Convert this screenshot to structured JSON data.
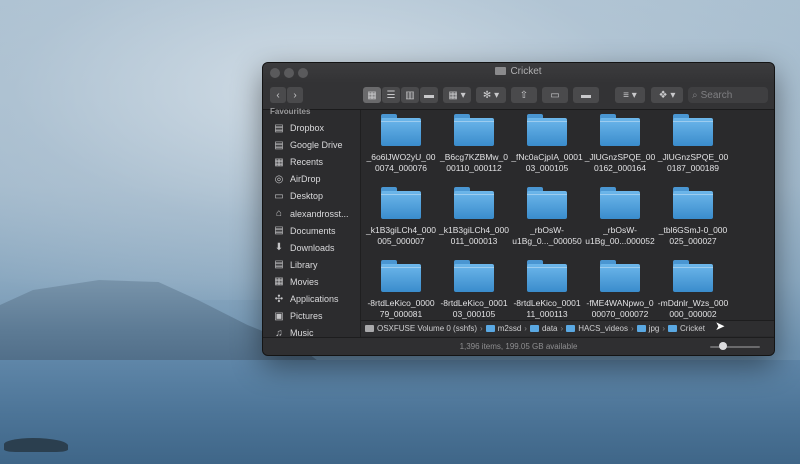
{
  "window": {
    "title": "Cricket"
  },
  "toolbar": {
    "back": "‹",
    "forward": "›",
    "search_placeholder": "Search"
  },
  "sidebar": {
    "heading": "Favourites",
    "items": [
      {
        "label": "Dropbox",
        "icon": "dropbox-icon",
        "glyph": "▤"
      },
      {
        "label": "Google Drive",
        "icon": "google-drive-icon",
        "glyph": "▤"
      },
      {
        "label": "Recents",
        "icon": "recents-icon",
        "glyph": "▦"
      },
      {
        "label": "AirDrop",
        "icon": "airdrop-icon",
        "glyph": "◎"
      },
      {
        "label": "Desktop",
        "icon": "desktop-icon",
        "glyph": "▭"
      },
      {
        "label": "alexandrosst...",
        "icon": "home-icon",
        "glyph": "⌂"
      },
      {
        "label": "Documents",
        "icon": "documents-icon",
        "glyph": "▤"
      },
      {
        "label": "Downloads",
        "icon": "downloads-icon",
        "glyph": "⬇"
      },
      {
        "label": "Library",
        "icon": "library-icon",
        "glyph": "▤"
      },
      {
        "label": "Movies",
        "icon": "movies-icon",
        "glyph": "▦"
      },
      {
        "label": "Applications",
        "icon": "applications-icon",
        "glyph": "✣"
      },
      {
        "label": "Pictures",
        "icon": "pictures-icon",
        "glyph": "▣"
      },
      {
        "label": "Music",
        "icon": "music-icon",
        "glyph": "♫"
      }
    ]
  },
  "files": [
    {
      "line1": "_6o6lJWO2yU_00",
      "line2": "0074_000076"
    },
    {
      "line1": "_B6cg7KZBMw_0",
      "line2": "00110_000112"
    },
    {
      "line1": "_fNc0aCjpIA_0001",
      "line2": "03_000105"
    },
    {
      "line1": "_JlUGnzSPQE_00",
      "line2": "0162_000164"
    },
    {
      "line1": "_JlUGnzSPQE_00",
      "line2": "0187_000189"
    },
    {
      "line1": "_k1B3giLCh4_000",
      "line2": "005_000007"
    },
    {
      "line1": "_k1B3giLCh4_000",
      "line2": "011_000013"
    },
    {
      "line1": "_rbOsW-",
      "line2": "u1Bg_0..._000050"
    },
    {
      "line1": "_rbOsW-",
      "line2": "u1Bg_00...000052"
    },
    {
      "line1": "_tbl6GSmJ-0_000",
      "line2": "025_000027"
    },
    {
      "line1": "-8rtdLeKico_0000",
      "line2": "79_000081"
    },
    {
      "line1": "-8rtdLeKico_0001",
      "line2": "03_000105"
    },
    {
      "line1": "-8rtdLeKico_0001",
      "line2": "11_000113"
    },
    {
      "line1": "-fME4WANpwo_0",
      "line2": "00070_000072"
    },
    {
      "line1": "-mDdnlr_Wzs_000",
      "line2": "000_000002"
    }
  ],
  "path": [
    "OSXFUSE Volume 0 (sshfs)",
    "m2ssd",
    "data",
    "HACS_videos",
    "jpg",
    "Cricket"
  ],
  "status": {
    "text": "1,396 items, 199.05 GB available"
  }
}
